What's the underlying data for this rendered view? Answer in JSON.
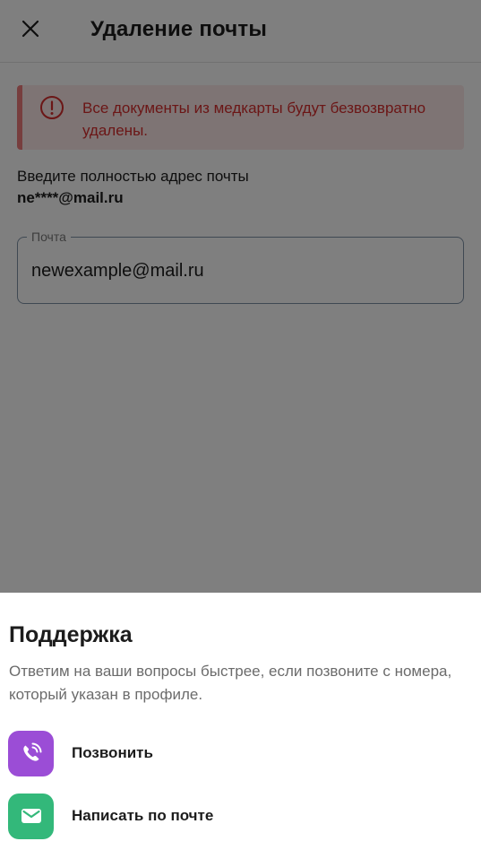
{
  "header": {
    "title": "Удаление почты",
    "close_icon": "close-icon"
  },
  "alert": {
    "text": "Все документы из медкарты будут безвозвратно удалены.",
    "icon": "alert-circle-icon",
    "color": "#d62c2c",
    "background": "#fde9e9"
  },
  "instruction": {
    "text": "Введите полностью адрес почты",
    "masked_email": "ne****@mail.ru"
  },
  "email_field": {
    "label": "Почта",
    "value": "newexample@mail.ru"
  },
  "support_sheet": {
    "title": "Поддержка",
    "description": "Ответим на ваши вопросы быстрее, если позвоните с номера, который указан в профиле.",
    "actions": [
      {
        "label": "Позвонить",
        "icon": "phone-call-icon",
        "color": "#9b4dd6"
      },
      {
        "label": "Написать по почте",
        "icon": "mail-icon",
        "color": "#33b87a"
      }
    ]
  }
}
